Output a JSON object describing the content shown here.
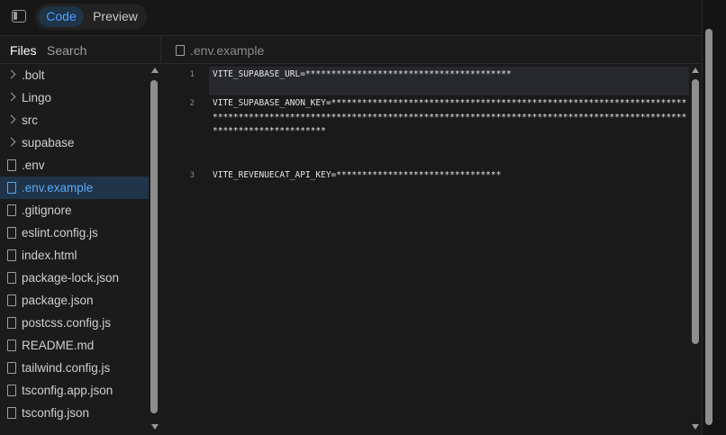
{
  "toolbar": {
    "code_label": "Code",
    "preview_label": "Preview"
  },
  "sidebar": {
    "tabs": {
      "files": "Files",
      "search": "Search"
    },
    "items": [
      {
        "label": ".bolt",
        "type": "folder"
      },
      {
        "label": "Lingo",
        "type": "folder"
      },
      {
        "label": "src",
        "type": "folder"
      },
      {
        "label": "supabase",
        "type": "folder"
      },
      {
        "label": ".env",
        "type": "file"
      },
      {
        "label": ".env.example",
        "type": "file",
        "selected": true
      },
      {
        "label": ".gitignore",
        "type": "file"
      },
      {
        "label": "eslint.config.js",
        "type": "file"
      },
      {
        "label": "index.html",
        "type": "file"
      },
      {
        "label": "package-lock.json",
        "type": "file"
      },
      {
        "label": "package.json",
        "type": "file"
      },
      {
        "label": "postcss.config.js",
        "type": "file"
      },
      {
        "label": "README.md",
        "type": "file"
      },
      {
        "label": "tailwind.config.js",
        "type": "file"
      },
      {
        "label": "tsconfig.app.json",
        "type": "file"
      },
      {
        "label": "tsconfig.json",
        "type": "file"
      }
    ]
  },
  "editor": {
    "filename": ".env.example",
    "lines": [
      {
        "number": "1",
        "text": "VITE_SUPABASE_URL=****************************************"
      },
      {
        "number": "2",
        "text": "VITE_SUPABASE_ANON_KEY=***************************************************************************************************************************************************************************************"
      },
      {
        "number": "3",
        "text": "VITE_REVENUECAT_API_KEY=********************************"
      }
    ]
  },
  "colors": {
    "accent": "#4aa3ff",
    "selected_bg": "#1f3349",
    "background": "#1a1a1a"
  },
  "icons": {
    "sidebar_toggle": "sidebar-toggle-icon",
    "folder": "chevron-right-icon",
    "file": "file-icon"
  }
}
